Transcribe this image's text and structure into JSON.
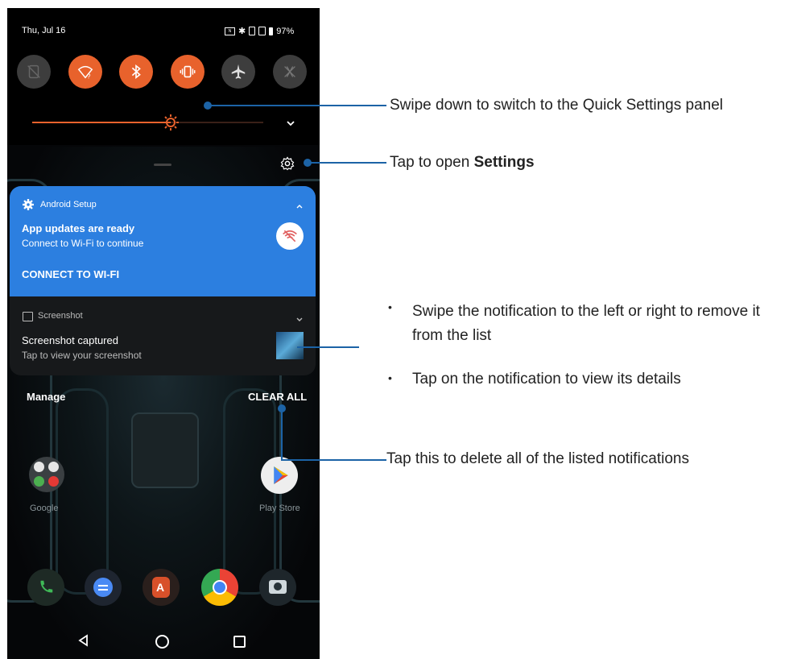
{
  "status_bar": {
    "date": "Thu, Jul 16",
    "battery": "97%"
  },
  "quick_settings": {
    "tiles": [
      {
        "name": "screen-rotation",
        "state": "off"
      },
      {
        "name": "wifi",
        "state": "on"
      },
      {
        "name": "bluetooth",
        "state": "on"
      },
      {
        "name": "vibrate",
        "state": "on"
      },
      {
        "name": "airplane",
        "state": "off"
      },
      {
        "name": "x-mode",
        "state": "off"
      }
    ],
    "brightness_level": 0.6
  },
  "notifications": {
    "android_setup": {
      "app": "Android Setup",
      "title": "App updates are ready",
      "body": "Connect to Wi-Fi to continue",
      "action": "CONNECT TO WI-FI"
    },
    "screenshot": {
      "app": "Screenshot",
      "title": "Screenshot captured",
      "body": "Tap to view your screenshot"
    }
  },
  "footer": {
    "manage": "Manage",
    "clear_all": "CLEAR ALL"
  },
  "home": {
    "google_label": "Google",
    "playstore_label": "Play Store"
  },
  "annotations": {
    "quick_settings": "Swipe down to switch to the Quick Settings panel",
    "settings_prefix": "Tap to open ",
    "settings_bold": "Settings",
    "bullet1": "Swipe the notification to the left or right to remove it from the list",
    "bullet2": "Tap on the notification to view its details",
    "clear_all": "Tap this to delete all of the listed notifications"
  },
  "colors": {
    "accent": "#e8622c",
    "notification_blue": "#2c7fe0",
    "callout": "#1c63a6"
  }
}
